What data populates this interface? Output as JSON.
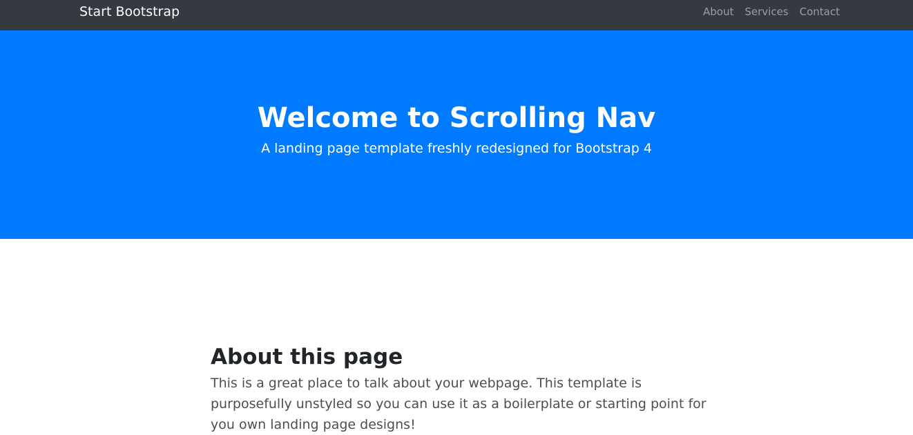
{
  "navbar": {
    "brand": "Start Bootstrap",
    "links": [
      "About",
      "Services",
      "Contact"
    ]
  },
  "hero": {
    "title": "Welcome to Scrolling Nav",
    "subtitle": "A landing page template freshly redesigned for Bootstrap 4"
  },
  "about": {
    "title": "About this page",
    "text": "This is a great place to talk about your webpage. This template is purposefully unstyled so you can use it as a boilerplate or starting point for you own landing page designs!"
  },
  "colors": {
    "navbar_bg": "#343a40",
    "hero_bg": "#007bff",
    "body_bg": "#ffffff"
  }
}
